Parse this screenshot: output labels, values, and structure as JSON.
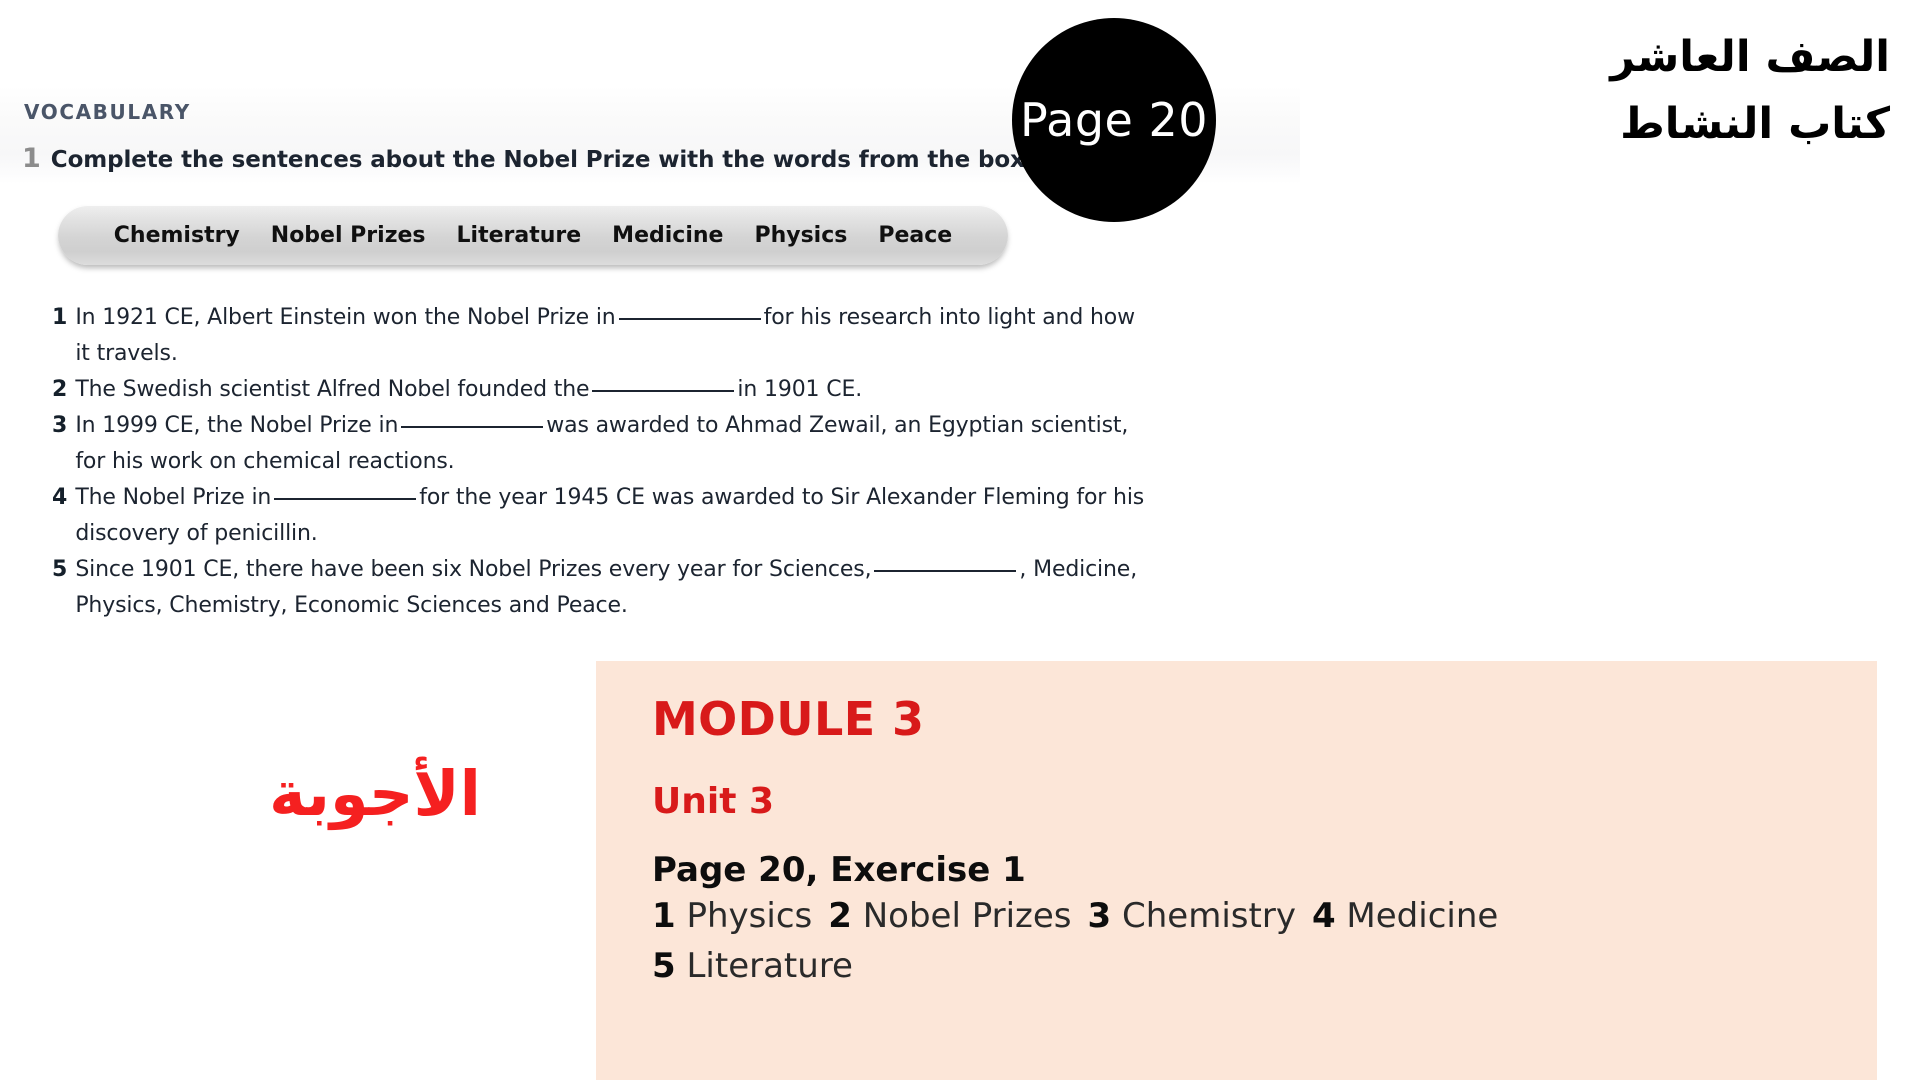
{
  "worksheet": {
    "section_label": "VOCABULARY",
    "exercise_number": "1",
    "instruction": "Complete the sentences about the Nobel Prize with the words from the box.",
    "word_bank": [
      "Chemistry",
      "Nobel Prizes",
      "Literature",
      "Medicine",
      "Physics",
      "Peace"
    ],
    "sentences": [
      {
        "number": "1",
        "before": "In 1921 CE, Albert Einstein won the Nobel Prize in",
        "after": "for his research into light and how it travels."
      },
      {
        "number": "2",
        "before": "The Swedish scientist Alfred Nobel founded the",
        "after": "in 1901 CE."
      },
      {
        "number": "3",
        "before": "In 1999 CE, the Nobel Prize in",
        "after": "was awarded to Ahmad Zewail, an Egyptian scientist, for his work on chemical reactions."
      },
      {
        "number": "4",
        "before": "The Nobel Prize in",
        "after": "for the year 1945 CE was awarded to Sir Alexander Fleming for his discovery of penicillin."
      },
      {
        "number": "5",
        "before": "Since 1901 CE, there have been six Nobel Prizes every year for Sciences,",
        "after": ", Medicine, Physics, Chemistry, Economic Sciences and Peace."
      }
    ]
  },
  "page_badge": {
    "label": "Page 20"
  },
  "arabic_header": {
    "line1": "الصف العاشر",
    "line2": "كتاب النشاط"
  },
  "answers_word": "الأجوبة",
  "answer_panel": {
    "module": "MODULE 3",
    "unit": "Unit 3",
    "exercise_heading": "Page 20, Exercise 1",
    "answers": [
      {
        "number": "1",
        "word": "Physics"
      },
      {
        "number": "2",
        "word": "Nobel Prizes"
      },
      {
        "number": "3",
        "word": "Chemistry"
      },
      {
        "number": "4",
        "word": "Medicine"
      },
      {
        "number": "5",
        "word": "Literature"
      }
    ]
  },
  "colors": {
    "panel_background": "#FCE6D8",
    "panel_red": "#D81A1A",
    "answers_word_red": "#F52020",
    "badge_black": "#000000",
    "wordbank_gray": "#D4D4D4"
  }
}
